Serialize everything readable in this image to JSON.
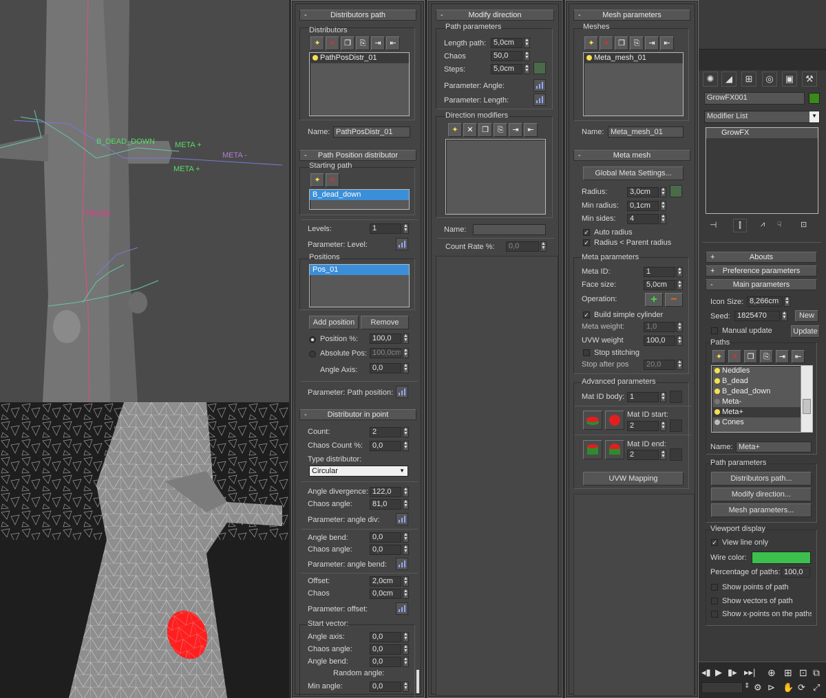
{
  "viewport_top": {
    "labels": {
      "b_dead_down": "B_DEAD_DOWN",
      "meta_plus_1": "META +",
      "meta_minus": "META -",
      "meta_plus_2": "META +",
      "trunk": "TRUNK"
    },
    "colors": {
      "bg": "#4a4a4a",
      "trunk": "#737373",
      "label_green": "#55dd66",
      "label_purple": "#b87ad8",
      "label_pink": "#ee3388"
    }
  },
  "viewport_bottom": {
    "colors": {
      "bg": "#1e1e1e",
      "mesh": "#9a9a9a",
      "highlight": "#ff2020"
    }
  },
  "distributors_path": {
    "title": "Distributors path",
    "distributors_group": "Distributors",
    "list": [
      "PathPosDistr_01"
    ],
    "name_label": "Name:",
    "name_value": "PathPosDistr_01",
    "path_position_title": "Path Position distributor",
    "starting_path_group": "Starting path",
    "starting_path_list": [
      "B_dead_down"
    ],
    "levels_label": "Levels:",
    "levels_value": "1",
    "param_level_label": "Parameter: Level:",
    "positions_group": "Positions",
    "positions_list": [
      "Pos_01"
    ],
    "add_position": "Add position",
    "remove": "Remove",
    "position_pct_label": "Position %:",
    "position_pct_value": "100,0",
    "absolute_pos_label": "Absolute Pos:",
    "absolute_pos_value": "100,0cm",
    "angle_axis_label": "Angle Axis:",
    "angle_axis_value": "0,0",
    "param_path_position": "Parameter: Path position:",
    "in_point_title": "Distributor in point",
    "count_label": "Count:",
    "count_value": "2",
    "chaos_count_label": "Chaos Count %:",
    "chaos_count_value": "0,0",
    "type_distributor_label": "Type distributor:",
    "type_distributor_value": "Circular",
    "angle_div_label": "Angle divergence:",
    "angle_div_value": "122,0",
    "chaos_angle_label": "Chaos angle:",
    "chaos_angle_value": "81,0",
    "param_angle_div": "Parameter: angle div:",
    "angle_bend_label": "Angle bend:",
    "angle_bend_value": "0,0",
    "chaos_angle2_label": "Chaos angle:",
    "chaos_angle2_value": "0,0",
    "param_angle_bend": "Parameter: angle bend:",
    "offset_label": "Offset:",
    "offset_value": "2,0cm",
    "chaos_label": "Chaos",
    "chaos_value": "0,0cm",
    "param_offset": "Parameter: offset:",
    "start_vector_group": "Start vector:",
    "sv_angle_axis_label": "Angle axis:",
    "sv_angle_axis_value": "0,0",
    "sv_chaos_angle_label": "Chaos angle:",
    "sv_chaos_angle_value": "0,0",
    "sv_angle_bend_label": "Angle bend:",
    "sv_angle_bend_value": "0,0",
    "random_angle": "Random angle:",
    "min_angle_label": "Min angle:",
    "min_angle_value": "0,0"
  },
  "modify_direction": {
    "title": "Modify direction",
    "path_params_group": "Path parameters",
    "length_path_label": "Length path:",
    "length_path_value": "5,0cm",
    "chaos_label": "Chaos",
    "chaos_value": "50,0",
    "steps_label": "Steps:",
    "steps_value": "5,0cm",
    "param_angle": "Parameter: Angle:",
    "param_length": "Parameter: Length:",
    "direction_modifiers_group": "Direction modifiers",
    "name_label": "Name:",
    "name_value": "",
    "count_rate_label": "Count Rate %:",
    "count_rate_value": "0,0"
  },
  "mesh_parameters": {
    "title": "Mesh parameters",
    "meshes_group": "Meshes",
    "list": [
      "Meta_mesh_01"
    ],
    "name_label": "Name:",
    "name_value": "Meta_mesh_01",
    "meta_mesh_title": "Meta mesh",
    "global_meta_settings": "Global Meta Settings...",
    "radius_label": "Radius:",
    "radius_value": "3,0cm",
    "min_radius_label": "Min radius:",
    "min_radius_value": "0,1cm",
    "min_sides_label": "Min sides:",
    "min_sides_value": "4",
    "auto_radius": "Auto radius",
    "radius_parent": "Radius < Parent radius",
    "meta_params_group": "Meta parameters",
    "meta_id_label": "Meta ID:",
    "meta_id_value": "1",
    "face_size_label": "Face size:",
    "face_size_value": "5,0cm",
    "operation_label": "Operation:",
    "build_cylinder": "Build simple cylinder",
    "meta_weight_label": "Meta weight:",
    "meta_weight_value": "1,0",
    "uvw_weight_label": "UVW weight",
    "uvw_weight_value": "100,0",
    "stop_stitching": "Stop stitching",
    "stop_after_pos_label": "Stop after pos",
    "stop_after_pos_value": "20,0",
    "advanced_group": "Advanced parameters",
    "mat_id_body_label": "Mat ID body:",
    "mat_id_body_value": "1",
    "mat_id_start_label": "Mat ID start:",
    "mat_id_start_value": "2",
    "mat_id_end_label": "Mat ID end:",
    "mat_id_end_value": "2",
    "uvw_mapping": "UVW Mapping"
  },
  "command_panel": {
    "object_name": "GrowFX001",
    "object_color": "#3a8a1a",
    "modifier_list": "Modifier List",
    "stack_item": "GrowFX",
    "abouts": "Abouts",
    "preference_parameters": "Preference parameters",
    "main_parameters": "Main parameters",
    "icon_size_label": "Icon Size:",
    "icon_size_value": "8,266cm",
    "seed_label": "Seed:",
    "seed_value": "1825470",
    "new_button": "New",
    "manual_update": "Manual update",
    "update_button": "Update",
    "paths_group": "Paths",
    "paths_list": [
      "Neddles",
      "B_dead",
      "B_dead_down",
      "Meta-",
      "Meta+",
      "Cones"
    ],
    "paths_selected": 4,
    "name_label": "Name:",
    "name_value": "Meta+",
    "path_params_group": "Path parameters",
    "distributors_path_btn": "Distributors path...",
    "modify_direction_btn": "Modify direction...",
    "mesh_parameters_btn": "Mesh parameters...",
    "viewport_display_group": "Viewport display",
    "view_line_only": "View line only",
    "wire_color_label": "Wire color:",
    "wire_color": "#3cbf4c",
    "percentage_label": "Percentage of paths:",
    "percentage_value": "100,0",
    "show_points": "Show points of path",
    "show_vectors": "Show vectors of path",
    "show_xpoints": "Show x-points on the paths"
  }
}
